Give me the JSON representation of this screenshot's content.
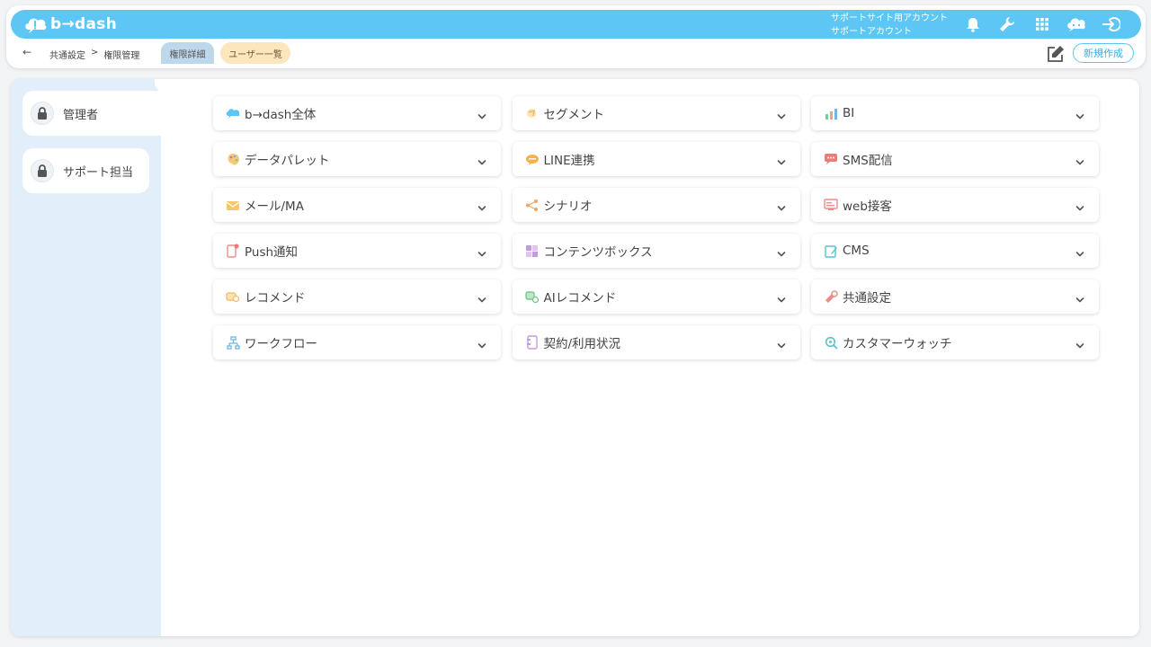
{
  "app": {
    "logo_text": "b→dash"
  },
  "account": {
    "line1": "サポートサイト用アカウント",
    "line2": "サポートアカウント"
  },
  "breadcrumb": {
    "part1": "共通設定",
    "separator": ">",
    "part2": "権限管理"
  },
  "tabs": {
    "detail": "権限詳細",
    "users": "ユーザー一覧"
  },
  "actions": {
    "new_label": "新規作成"
  },
  "roles": [
    {
      "label": "管理者"
    },
    {
      "label": "サポート担当"
    }
  ],
  "categories": [
    {
      "label": "b→dash全体",
      "icon": "bdash-icon"
    },
    {
      "label": "セグメント",
      "icon": "segment-icon"
    },
    {
      "label": "BI",
      "icon": "bi-icon"
    },
    {
      "label": "データパレット",
      "icon": "palette-icon"
    },
    {
      "label": "LINE連携",
      "icon": "line-icon"
    },
    {
      "label": "SMS配信",
      "icon": "sms-icon"
    },
    {
      "label": "メール/MA",
      "icon": "mail-icon"
    },
    {
      "label": "シナリオ",
      "icon": "scenario-icon"
    },
    {
      "label": "web接客",
      "icon": "web-icon"
    },
    {
      "label": "Push通知",
      "icon": "push-icon"
    },
    {
      "label": "コンテンツボックス",
      "icon": "contents-icon"
    },
    {
      "label": "CMS",
      "icon": "cms-icon"
    },
    {
      "label": "レコメンド",
      "icon": "recommend-icon"
    },
    {
      "label": "AIレコメンド",
      "icon": "ai-recommend-icon"
    },
    {
      "label": "共通設定",
      "icon": "settings-icon"
    },
    {
      "label": "ワークフロー",
      "icon": "workflow-icon"
    },
    {
      "label": "契約/利用状況",
      "icon": "contract-icon"
    },
    {
      "label": "カスタマーウォッチ",
      "icon": "customer-watch-icon"
    }
  ],
  "colors": {
    "brand": "#5ec6f5",
    "sidebar": "#e2eef9",
    "tab_detail": "#bfd7ea",
    "tab_users": "#fbe6bd"
  }
}
